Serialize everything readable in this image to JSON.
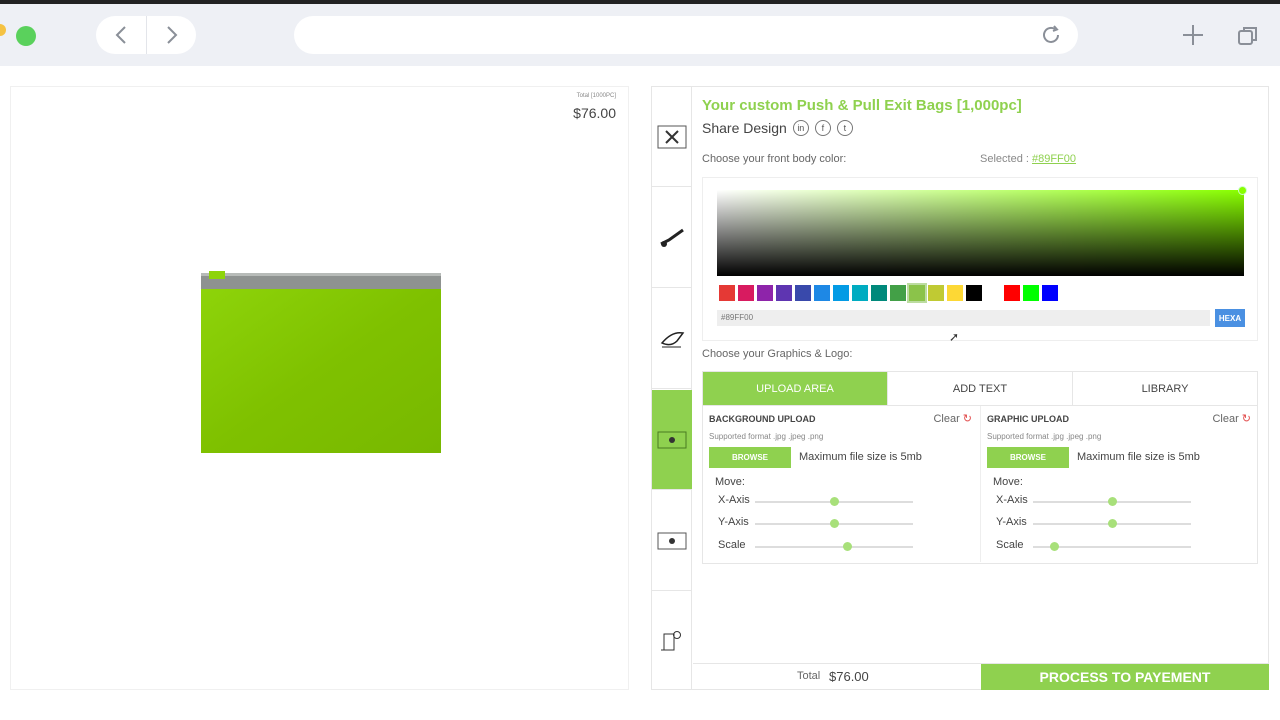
{
  "browser": {
    "back_icon": "chevron-left-icon",
    "forward_icon": "chevron-right-icon",
    "url": "",
    "reload_icon": "reload-icon",
    "new_tab_icon": "plus-icon",
    "tabs_icon": "tabs-icon"
  },
  "preview": {
    "total_label": "Total [1000PC]",
    "price": "$76.00",
    "bag_color": "#89FF00"
  },
  "sidebar": {
    "tabs": [
      {
        "icon": "tools-icon"
      },
      {
        "icon": "brush-icon"
      },
      {
        "icon": "pen-icon"
      },
      {
        "icon": "upload-area-icon"
      },
      {
        "icon": "image-icon"
      },
      {
        "icon": "design-icon"
      }
    ]
  },
  "customizer": {
    "title": "Your custom Push & Pull Exit Bags [1,000pc]",
    "share_label": "Share Design",
    "social": [
      "in",
      "f",
      "t"
    ],
    "front_color_label": "Choose your front body color:",
    "selected_label": "Selected :",
    "selected_value": "#89FF00",
    "hex_value": "#89FF00",
    "hex_button": "HEXA",
    "swatches": [
      "#e53935",
      "#d81b60",
      "#8e24aa",
      "#5e35b1",
      "#3949ab",
      "#1e88e5",
      "#039be5",
      "#00acc1",
      "#00897b",
      "#43a047",
      "#8bc34a",
      "#c0ca33",
      "#fdd835",
      "#000000",
      "#ffffff",
      "#ff0000",
      "#00ff00",
      "#0000ff",
      "#ffffff"
    ],
    "graphics_label": "Choose your Graphics & Logo:",
    "tabs": [
      "UPLOAD AREA",
      "ADD TEXT",
      "LIBRARY"
    ],
    "background_upload": {
      "title": "BACKGROUND UPLOAD",
      "clear": "Clear",
      "formats": "Supported format .jpg .jpeg .png",
      "browse": "BROWSE",
      "max": "Maximum file size is 5mb",
      "move": "Move:",
      "x_label": "X-Axis",
      "y_label": "Y-Axis",
      "scale_label": "Scale",
      "x_value": 0.5,
      "y_value": 0.5,
      "scale_value": 0.58
    },
    "graphic_upload": {
      "title": "GRAPHIC UPLOAD",
      "clear": "Clear",
      "formats": "Supported format .jpg .jpeg .png",
      "browse": "BROWSE",
      "max": "Maximum file size is 5mb",
      "move": "Move:",
      "x_label": "X-Axis",
      "y_label": "Y-Axis",
      "scale_label": "Scale",
      "x_value": 0.5,
      "y_value": 0.5,
      "scale_value": 0.13
    },
    "total_label": "Total",
    "total_value": "$76.00",
    "pay_button": "PROCESS TO PAYEMENT"
  }
}
